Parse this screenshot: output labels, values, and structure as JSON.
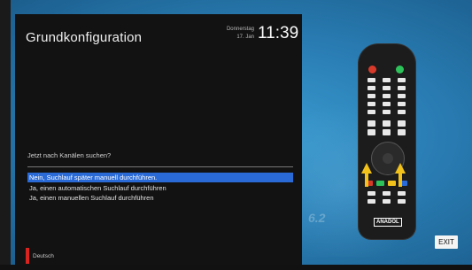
{
  "screen": {
    "title": "Grundkonfiguration",
    "clock_day": "Donnerstag",
    "clock_date": "17. Jan",
    "clock_time": "11:39"
  },
  "prompt": {
    "question": "Jetzt nach Kanälen suchen?",
    "options": [
      {
        "label": "Nein, Suchlauf später manuell durchführen.",
        "selected": true
      },
      {
        "label": "Ja, einen automatischen Suchlauf durchführen",
        "selected": false
      },
      {
        "label": "Ja, einen manuellen Suchlauf durchführen",
        "selected": false
      }
    ]
  },
  "footer": {
    "language": "Deutsch",
    "exit_label": "EXIT"
  },
  "remote": {
    "brand": "ANADOL"
  },
  "colors": {
    "selection": "#2a6ad6",
    "language_marker": "#d8231e",
    "arrow": "#f2c21b"
  },
  "background": {
    "logo_text": "6.2"
  }
}
